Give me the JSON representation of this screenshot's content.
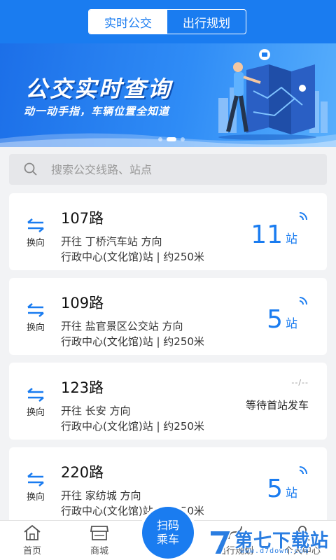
{
  "header": {
    "tabs": [
      {
        "label": "实时公交",
        "active": true
      },
      {
        "label": "出行规划",
        "active": false
      }
    ]
  },
  "banner": {
    "title": "公交实时查询",
    "subtitle": "动一动手指，车辆位置全知道"
  },
  "search": {
    "placeholder": "搜索公交线路、站点"
  },
  "routes": [
    {
      "name": "107路",
      "direction": "开往 丁桥汽车站 方向",
      "station": "行政中心(文化馆)站 | 约250米",
      "swap_label": "换向",
      "arrival_num": "11",
      "arrival_unit": "站",
      "status": ""
    },
    {
      "name": "109路",
      "direction": "开往 盐官景区公交站 方向",
      "station": "行政中心(文化馆)站 | 约250米",
      "swap_label": "换向",
      "arrival_num": "5",
      "arrival_unit": "站",
      "status": ""
    },
    {
      "name": "123路",
      "direction": "开往 长安 方向",
      "station": "行政中心(文化馆)站 | 约250米",
      "swap_label": "换向",
      "arrival_num": "",
      "arrival_unit": "",
      "status": "等待首站发车",
      "status_dash": "--/--"
    },
    {
      "name": "220路",
      "direction": "开往 家纺城 方向",
      "station": "行政中心(文化馆)站 | 约250米",
      "swap_label": "换向",
      "arrival_num": "5",
      "arrival_unit": "站",
      "status": ""
    }
  ],
  "nav": {
    "items": [
      {
        "label": "首页",
        "icon": "home-icon"
      },
      {
        "label": "商城",
        "icon": "shop-icon"
      },
      {
        "label": "出行规划",
        "icon": "route-icon"
      },
      {
        "label": "个人中心",
        "icon": "user-icon"
      }
    ],
    "scan_line1": "扫码",
    "scan_line2": "乘车"
  },
  "watermark": {
    "text": "第七下载站",
    "url": "www.d7down.com"
  },
  "colors": {
    "primary": "#1a7cf0",
    "background": "#f2f3f5"
  }
}
